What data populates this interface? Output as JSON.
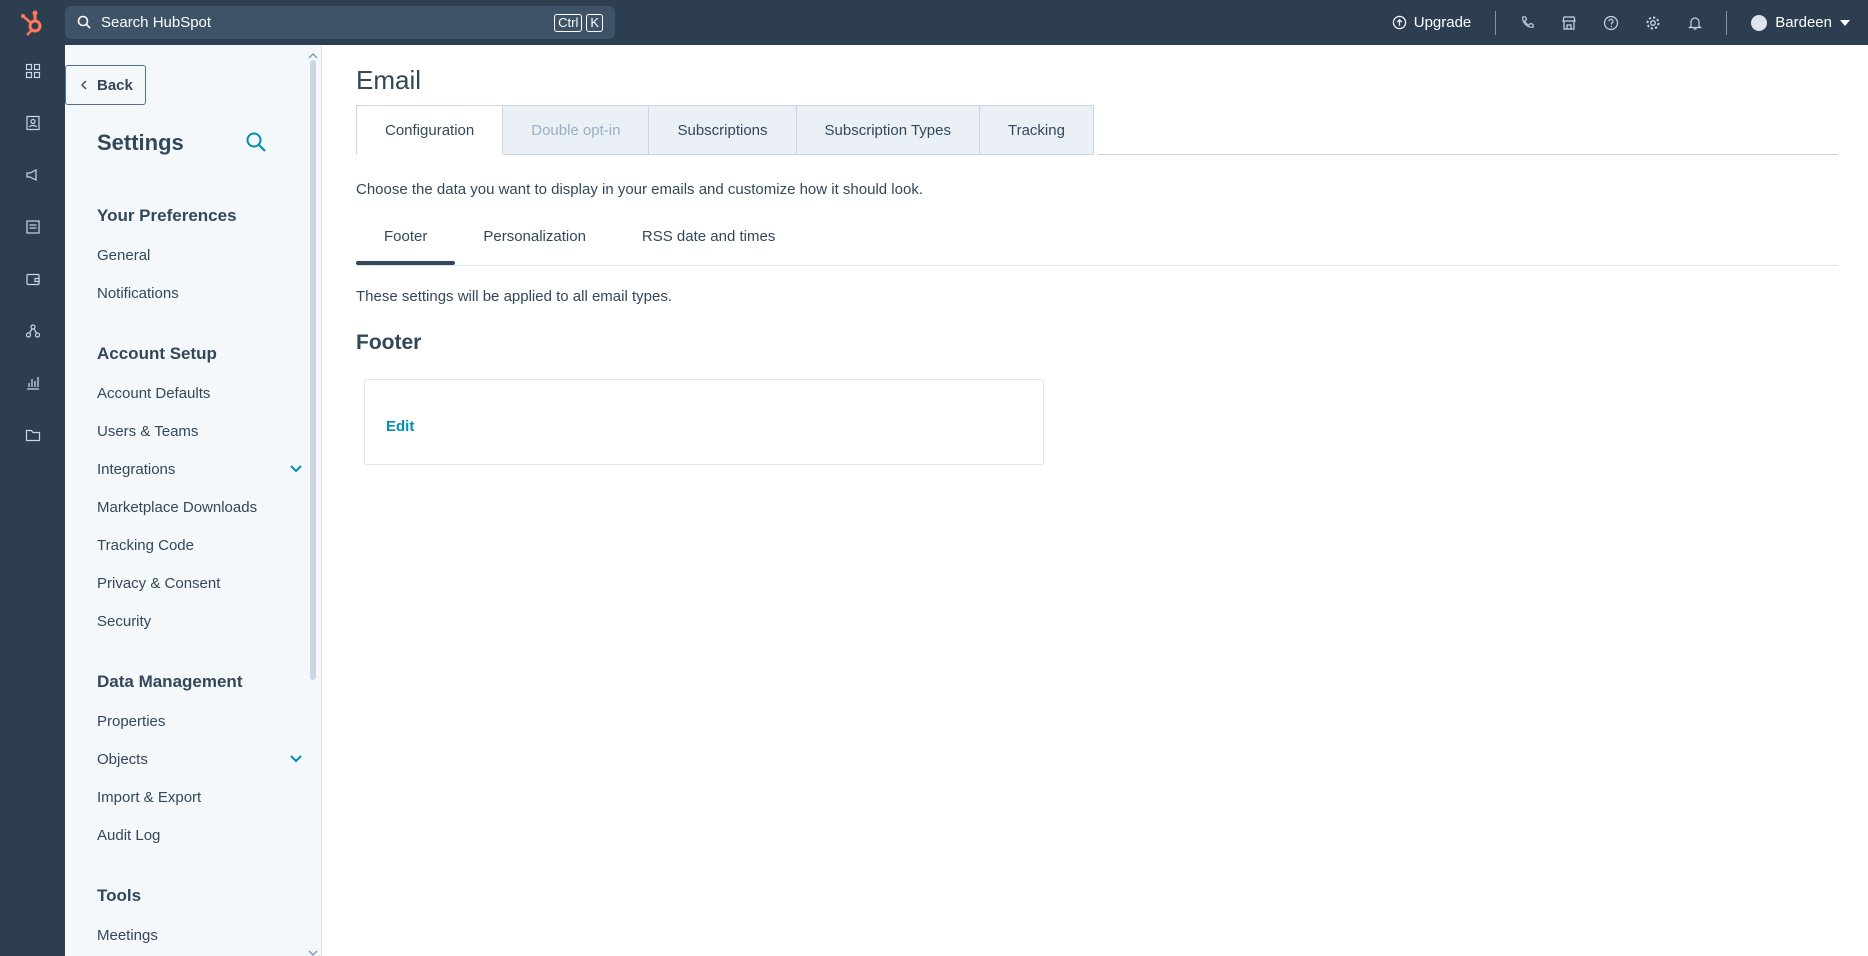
{
  "topbar": {
    "search_placeholder": "Search HubSpot",
    "kbd_ctrl": "Ctrl",
    "kbd_k": "K",
    "upgrade_label": "Upgrade",
    "user_name": "Bardeen",
    "icons": [
      "phone-icon",
      "marketplace-icon",
      "help-icon",
      "settings-icon",
      "notifications-icon"
    ]
  },
  "rail": {
    "icons": [
      "bookmarks-icon",
      "contacts-icon",
      "marketing-icon",
      "content-icon",
      "commerce-icon",
      "automations-icon",
      "reporting-icon",
      "library-icon"
    ]
  },
  "sidebar": {
    "back_label": "Back",
    "title": "Settings",
    "sections": [
      {
        "title": "Your Preferences",
        "items": [
          {
            "label": "General"
          },
          {
            "label": "Notifications"
          }
        ]
      },
      {
        "title": "Account Setup",
        "items": [
          {
            "label": "Account Defaults"
          },
          {
            "label": "Users & Teams"
          },
          {
            "label": "Integrations",
            "expandable": true
          },
          {
            "label": "Marketplace Downloads"
          },
          {
            "label": "Tracking Code"
          },
          {
            "label": "Privacy & Consent"
          },
          {
            "label": "Security"
          }
        ]
      },
      {
        "title": "Data Management",
        "items": [
          {
            "label": "Properties"
          },
          {
            "label": "Objects",
            "expandable": true
          },
          {
            "label": "Import & Export"
          },
          {
            "label": "Audit Log"
          }
        ]
      },
      {
        "title": "Tools",
        "items": [
          {
            "label": "Meetings"
          }
        ]
      }
    ]
  },
  "main": {
    "title": "Email",
    "tabs": [
      {
        "label": "Configuration",
        "state": "active"
      },
      {
        "label": "Double opt-in",
        "state": "disabled"
      },
      {
        "label": "Subscriptions",
        "state": "normal"
      },
      {
        "label": "Subscription Types",
        "state": "normal"
      },
      {
        "label": "Tracking",
        "state": "normal"
      }
    ],
    "description": "Choose the data you want to display in your emails and customize how it should look.",
    "subtabs": [
      {
        "label": "Footer",
        "state": "active"
      },
      {
        "label": "Personalization",
        "state": "normal"
      },
      {
        "label": "RSS date and times",
        "state": "normal"
      }
    ],
    "applied_note": "These settings will be applied to all email types.",
    "footer_title": "Footer",
    "edit_label": "Edit"
  },
  "colors": {
    "nav_bg": "#2d3e50",
    "sidebar_bg": "#f5f8fa",
    "link": "#0091ae",
    "text": "#33475b",
    "logo": "#ff7a59"
  }
}
